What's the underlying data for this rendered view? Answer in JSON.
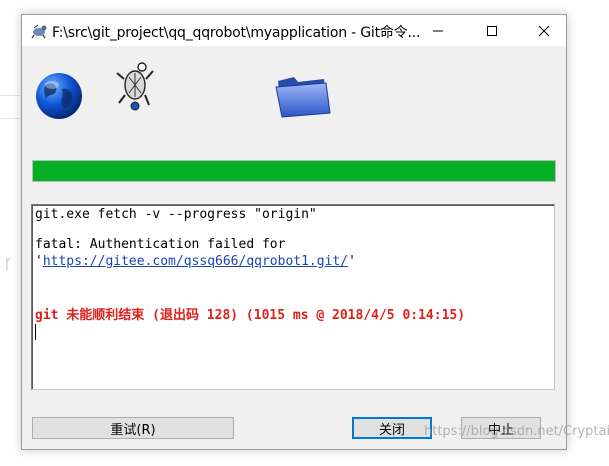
{
  "window": {
    "title": "F:\\src\\git_project\\qq_qqrobot\\myapplication - Git命令..."
  },
  "progress": {
    "fraction": 1.0,
    "color": "#06b025"
  },
  "log": {
    "line1": "git.exe fetch -v --progress \"origin\"",
    "line2": "fatal: Authentication failed for",
    "line3_pre": "'",
    "line3_link": "https://gitee.com/qssq666/qqrobot1.git/",
    "line3_post": "'",
    "line4": "git 未能顺利结束 (退出码 128) (1015 ms @ 2018/4/5 0:14:15)"
  },
  "buttons": {
    "retry": "重试(R)",
    "close": "关闭",
    "abort": "中止"
  },
  "watermark": "https://blog.csdn.net/Cryptaiqy",
  "icons": {
    "app": "tortoise-git-icon",
    "globe": "globe-icon",
    "tortoise": "tortoise-icon",
    "folder": "folder-icon"
  },
  "colors": {
    "error": "#e0201a",
    "link": "#1a44b8",
    "accent": "#0078d7"
  }
}
